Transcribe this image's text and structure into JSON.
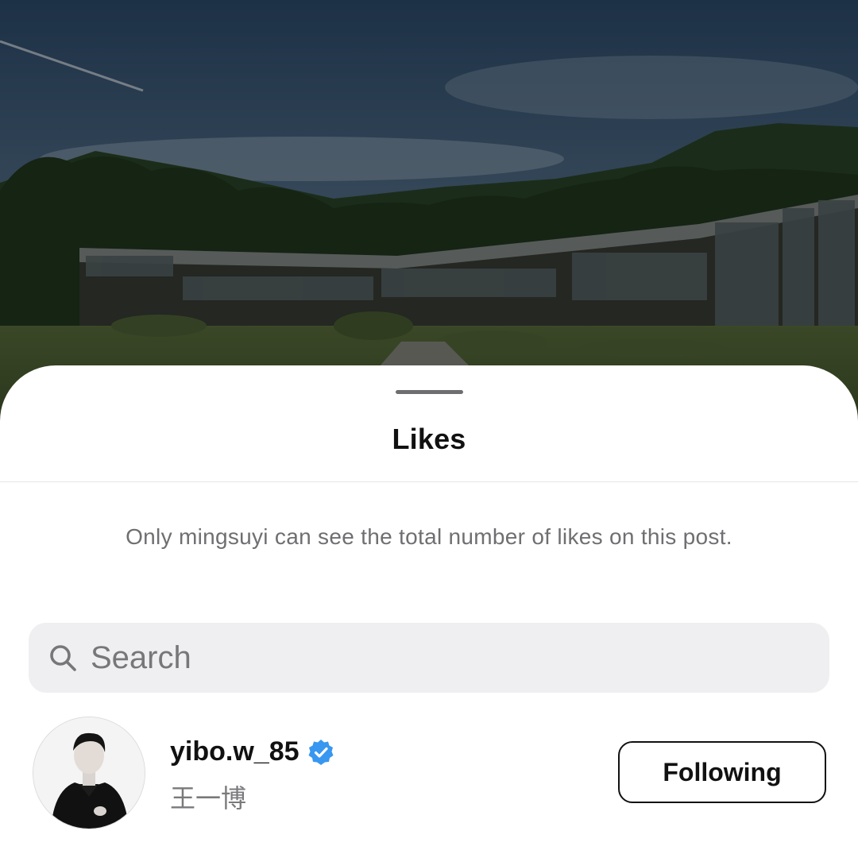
{
  "sheet": {
    "title": "Likes",
    "notice": "Only mingsuyi can see the total number of likes on this post."
  },
  "search": {
    "placeholder": "Search",
    "icon": "search-icon"
  },
  "likers": [
    {
      "username": "yibo.w_85",
      "full_name": "王一博",
      "verified": true,
      "follow_state": "Following"
    }
  ],
  "colors": {
    "verified_badge": "#3897f0",
    "sheet_background": "#ffffff",
    "search_background": "#efeff1",
    "secondary_text": "#6f6f72"
  }
}
